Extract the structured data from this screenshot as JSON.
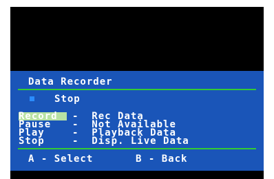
{
  "title": "Data Recorder",
  "status": {
    "icon": "stop-square-icon",
    "text": "Stop"
  },
  "menu": [
    {
      "label": "Record",
      "dash": "-",
      "desc": "Rec Data",
      "selected": true
    },
    {
      "label": "Pause",
      "dash": "-",
      "desc": "Not Available",
      "selected": false
    },
    {
      "label": "Play",
      "dash": "-",
      "desc": "Playback Data",
      "selected": false
    },
    {
      "label": "Stop",
      "dash": "-",
      "desc": "Disp. Live Data",
      "selected": false
    }
  ],
  "footer": {
    "select": "A - Select",
    "back": "B - Back"
  },
  "colors": {
    "screen": "#000000",
    "panel": "#1a55b8",
    "divider": "#33cc33",
    "highlight": "#b8e2a4",
    "status_icon": "#2a8cff"
  }
}
